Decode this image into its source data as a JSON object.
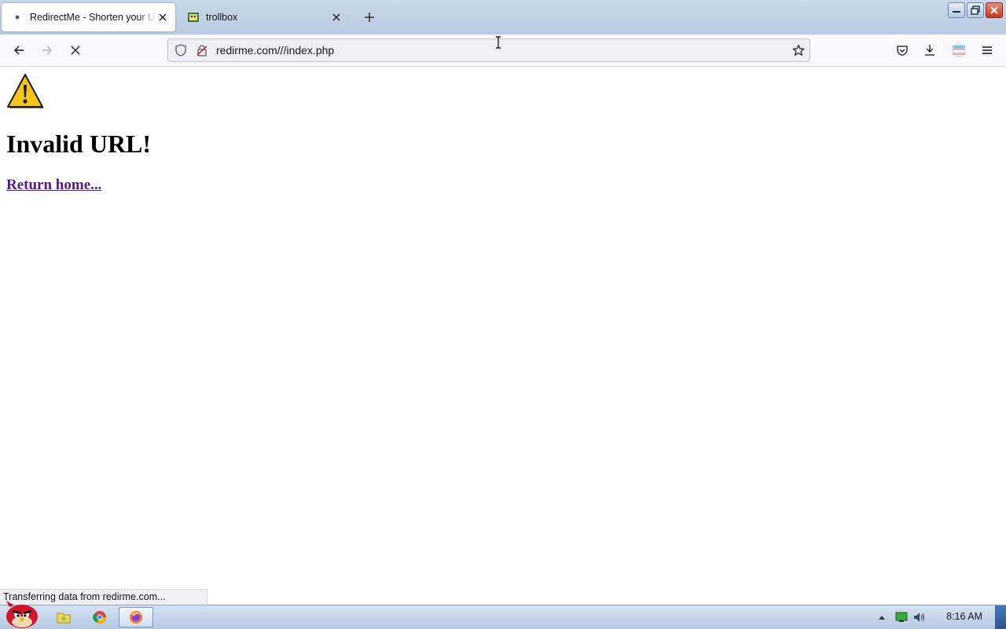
{
  "tabs": [
    {
      "title": "RedirectMe - Shorten your URLs",
      "active": true
    },
    {
      "title": "trollbox",
      "active": false
    }
  ],
  "navbar": {
    "url": "redirme.com///index.php"
  },
  "page": {
    "heading": "Invalid URL!",
    "link": "Return home..."
  },
  "status_text": "Transferring data from redirme.com...",
  "taskbar": {
    "clock": "8:16 AM"
  },
  "colors": {
    "link_visited": "#551a8b",
    "tabstrip": "#c9d8ea",
    "warning_yellow": "#f5c518"
  }
}
